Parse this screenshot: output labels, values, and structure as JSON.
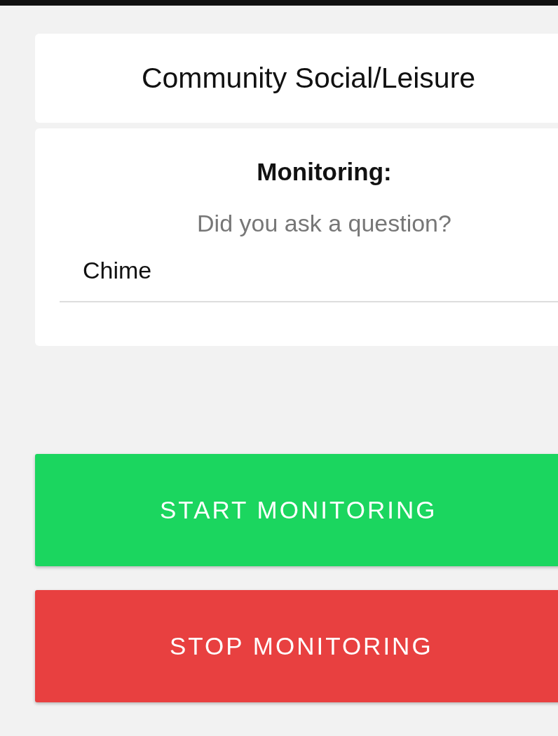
{
  "header": {
    "title": "Community Social/Leisure"
  },
  "monitor_card": {
    "heading": "Monitoring:",
    "question": "Did you ask a question?",
    "field": {
      "value": "Chime"
    }
  },
  "buttons": [
    {
      "label": "START MONITORING",
      "kind": "start"
    },
    {
      "label": "STOP MONITORING",
      "kind": "stop"
    }
  ]
}
